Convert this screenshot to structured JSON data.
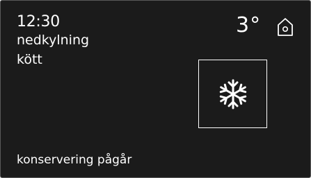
{
  "header": {
    "time": "12:30",
    "program": "nedkylning",
    "food": "kött",
    "temperature": "3°"
  },
  "icons": {
    "home": "home-icon",
    "mode": "snowflake-icon"
  },
  "footer": {
    "status": "konservering pågår"
  },
  "colors": {
    "background": "#1b1b1b",
    "foreground": "#ffffff"
  }
}
